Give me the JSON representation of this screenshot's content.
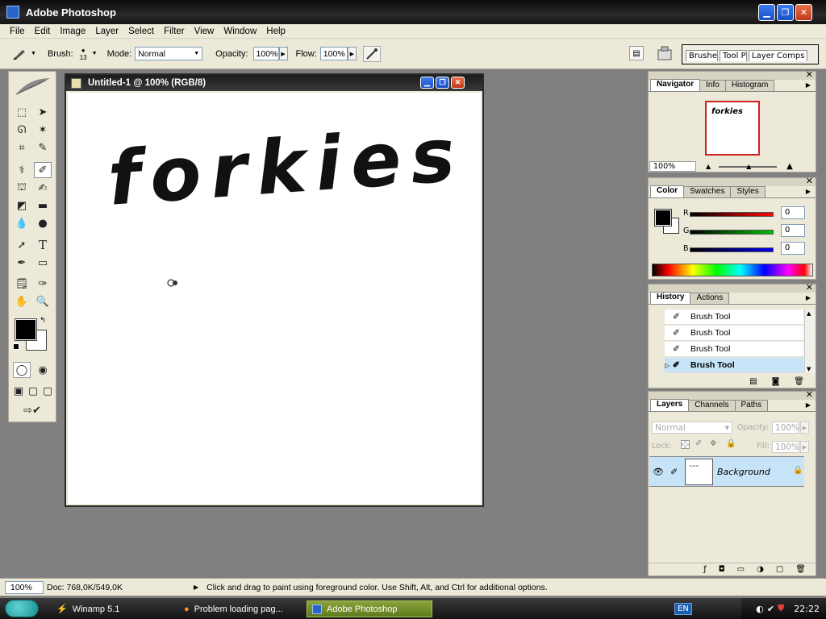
{
  "app": {
    "title": "Adobe Photoshop"
  },
  "menu": [
    "File",
    "Edit",
    "Image",
    "Layer",
    "Select",
    "Filter",
    "View",
    "Window",
    "Help"
  ],
  "options": {
    "brush_label": "Brush:",
    "brush_size": "13",
    "mode_label": "Mode:",
    "mode_value": "Normal",
    "opacity_label": "Opacity:",
    "opacity_value": "100%",
    "flow_label": "Flow:",
    "flow_value": "100%"
  },
  "palette_well": [
    "Brushe",
    "Tool P",
    "Layer Comps"
  ],
  "document": {
    "title": "Untitled-1 @ 100% (RGB/8)",
    "canvas_text": "forkies"
  },
  "navigator": {
    "tabs": [
      "Navigator",
      "Info",
      "Histogram"
    ],
    "zoom": "100%",
    "thumb_text": "forkies"
  },
  "color": {
    "tabs": [
      "Color",
      "Swatches",
      "Styles"
    ],
    "channels": [
      {
        "label": "R",
        "value": "0",
        "color": "#ff0000"
      },
      {
        "label": "G",
        "value": "0",
        "color": "#00b000"
      },
      {
        "label": "B",
        "value": "0",
        "color": "#0000dd"
      }
    ]
  },
  "history": {
    "tabs": [
      "History",
      "Actions"
    ],
    "items": [
      "Brush Tool",
      "Brush Tool",
      "Brush Tool",
      "Brush Tool"
    ]
  },
  "layers": {
    "tabs": [
      "Layers",
      "Channels",
      "Paths"
    ],
    "blend_mode": "Normal",
    "opacity_label": "Opacity:",
    "opacity_value": "100%",
    "lock_label": "Lock:",
    "fill_label": "Fill:",
    "fill_value": "100%",
    "layer_name": "Background"
  },
  "status": {
    "zoom": "100%",
    "doc_info": "Doc: 768,0K/549,0K",
    "hint": "Click and drag to paint using foreground color.  Use Shift, Alt, and Ctrl for additional options."
  },
  "taskbar": {
    "items": [
      "Winamp 5.1",
      "Problem loading pag...",
      "Adobe Photoshop"
    ],
    "language": "EN",
    "clock": "22:22"
  }
}
